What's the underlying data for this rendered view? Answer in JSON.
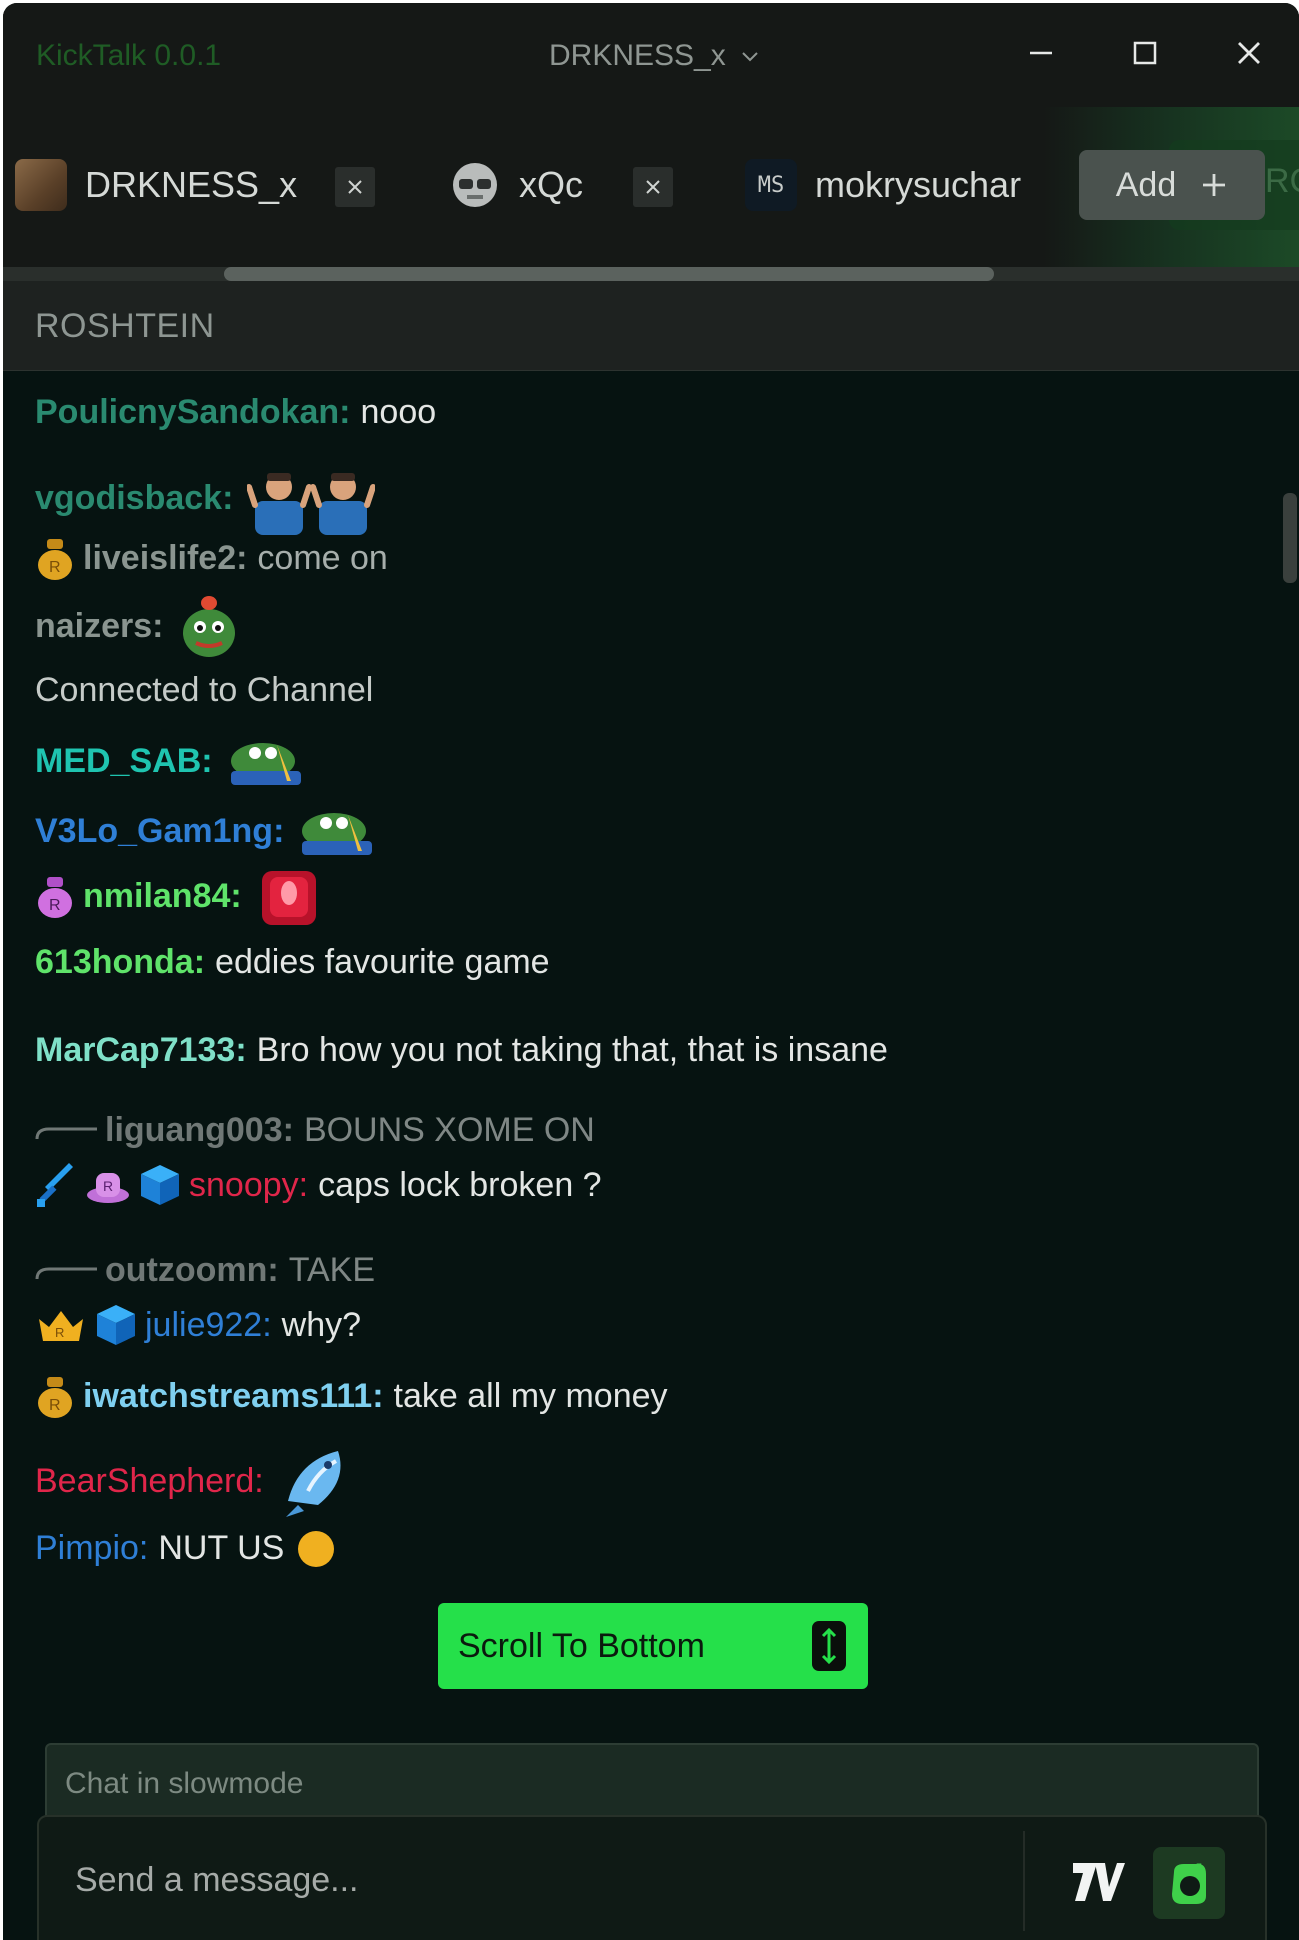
{
  "app": {
    "name": "KickTalk 0.0.1",
    "current_channel": "DRKNESS_x"
  },
  "tabs": [
    {
      "label": "DRKNESS_x"
    },
    {
      "label": "xQc"
    },
    {
      "label": "mokrysuchar",
      "avatar_text": "MS"
    }
  ],
  "add_button": {
    "label": "Add"
  },
  "hidden_tab_label": "RC",
  "channel_header": {
    "title": "ROSHTEIN"
  },
  "messages": [
    {
      "user": "PoulicnySandokan:",
      "text": "nooo",
      "color": "#2a8a70"
    },
    {
      "user": "vgodisback:",
      "text": "",
      "color": "#2a8a70"
    },
    {
      "user": "liveislife2:",
      "text": "come on",
      "color": "#8a9590"
    },
    {
      "user": "naizers:",
      "text": "",
      "color": "#8a9590"
    },
    {
      "system": "Connected to Channel"
    },
    {
      "user": "MED_SAB:",
      "text": "",
      "color": "#1fc4b0"
    },
    {
      "user": "V3Lo_Gam1ng:",
      "text": "",
      "color": "#2f7fd6"
    },
    {
      "user": "nmilan84:",
      "text": "",
      "color": "#5fe36a"
    },
    {
      "user": "613honda:",
      "text": "eddies favourite game",
      "color": "#5fe36a"
    },
    {
      "user": "MarCap7133:",
      "text": "Bro how you not taking that, that is insane",
      "color": "#7fe0c8"
    },
    {
      "user": "liguang003:",
      "text": "BOUNS XOME ON",
      "color": "#c8ccca"
    },
    {
      "user": "snoopy:",
      "text": "caps lock broken ?",
      "color": "#e0264a"
    },
    {
      "user": "outzoomn:",
      "text": "TAKE",
      "color": "#c8ccca"
    },
    {
      "user": "julie922:",
      "text": "why?",
      "color": "#2f7fd6"
    },
    {
      "user": "iwatchstreams111:",
      "text": "take all my money",
      "color": "#7fd0f0"
    },
    {
      "user": "BearShepherd:",
      "text": "",
      "color": "#e0264a"
    },
    {
      "user": "Pimpio:",
      "text": "NUT US",
      "color": "#2f7fd6"
    }
  ],
  "scroll_to_bottom": {
    "label": "Scroll To Bottom"
  },
  "slowmode_notice": "Chat in slowmode",
  "input": {
    "placeholder": "Send a message..."
  },
  "colors": {
    "accent": "#25e04a",
    "background": "#061311",
    "titlebar": "#151816"
  }
}
